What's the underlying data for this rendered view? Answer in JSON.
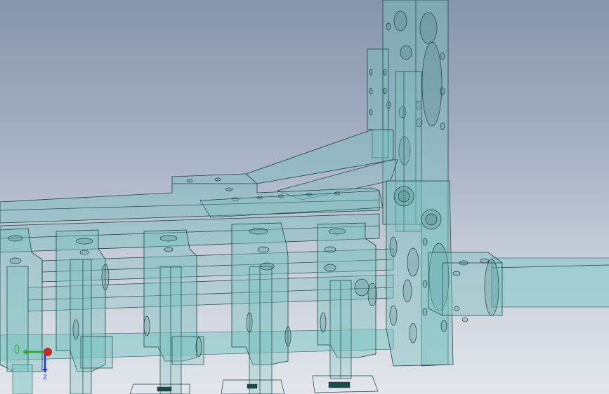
{
  "viewport": {
    "background_top": "#8795ad",
    "background_bottom": "#e3e6ec"
  },
  "model": {
    "render_mode": "transparent-shaded-with-edges",
    "fill_color": "#7fc3c1",
    "edge_color": "#1d4242"
  },
  "triad": {
    "x_axis_color": "#2fa82f",
    "y_axis_color": "#c32a2a",
    "z_axis_color": "#2845c8",
    "x_label": "",
    "z_label": "Z",
    "icon": "coordinate-triad-icon"
  }
}
